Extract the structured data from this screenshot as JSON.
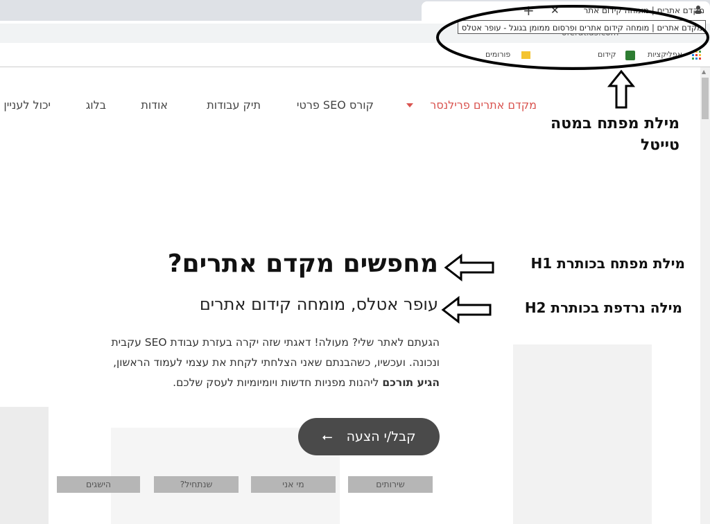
{
  "browser": {
    "tab_title": "מקדם אתרים | מומחה קידום אתר",
    "new_tab_label": "+",
    "close_label": "✕",
    "url": "oferatlas.com",
    "bookmarks": [
      {
        "label": "אפליקציות"
      },
      {
        "label": "קידום"
      },
      {
        "label": "פורומים"
      }
    ],
    "tooltip": "מקדם אתרים | מומחה קידום אתרים ופרסום ממומן בגוגל - עופר אטלס"
  },
  "nav": {
    "items": [
      {
        "label": "מקדם אתרים פרילנסר"
      },
      {
        "label": "קורס SEO פרטי"
      },
      {
        "label": "תיק עבודות"
      },
      {
        "label": "אודות"
      },
      {
        "label": "בלוג"
      },
      {
        "label": "יכול לעניין"
      }
    ]
  },
  "hero": {
    "h1": "מחפשים מקדם אתרים?",
    "h2": "עופר אטלס, מומחה קידום אתרים",
    "body_line1": "הגעתם לאתר שלי? מעולה! דאגתי שזה יקרה בעזרת עבודת SEO עקבית",
    "body_line2": "ונכונה. ועכשיו, כשהבנתם שאני הצלחתי לקחת את עצמי לעמוד הראשון,",
    "body_bold": "הגיע תורכם",
    "body_line3": " ליהנות מפניות חדשות ויומיומיות לעסק שלכם.",
    "cta": "קבל/י הצעה",
    "cta_arrow": "⭠"
  },
  "section_tabs": [
    {
      "label": "שירותים"
    },
    {
      "label": "מי אני"
    },
    {
      "label": "שנתחיל?"
    },
    {
      "label": "הישגים"
    }
  ],
  "annotations": {
    "title_line1": "מילת מפתח במטה",
    "title_line2": "טייטל",
    "h1": "מילת מפתח בכותרת H1",
    "h2": "מילה נרדפת בכותרת H2"
  }
}
